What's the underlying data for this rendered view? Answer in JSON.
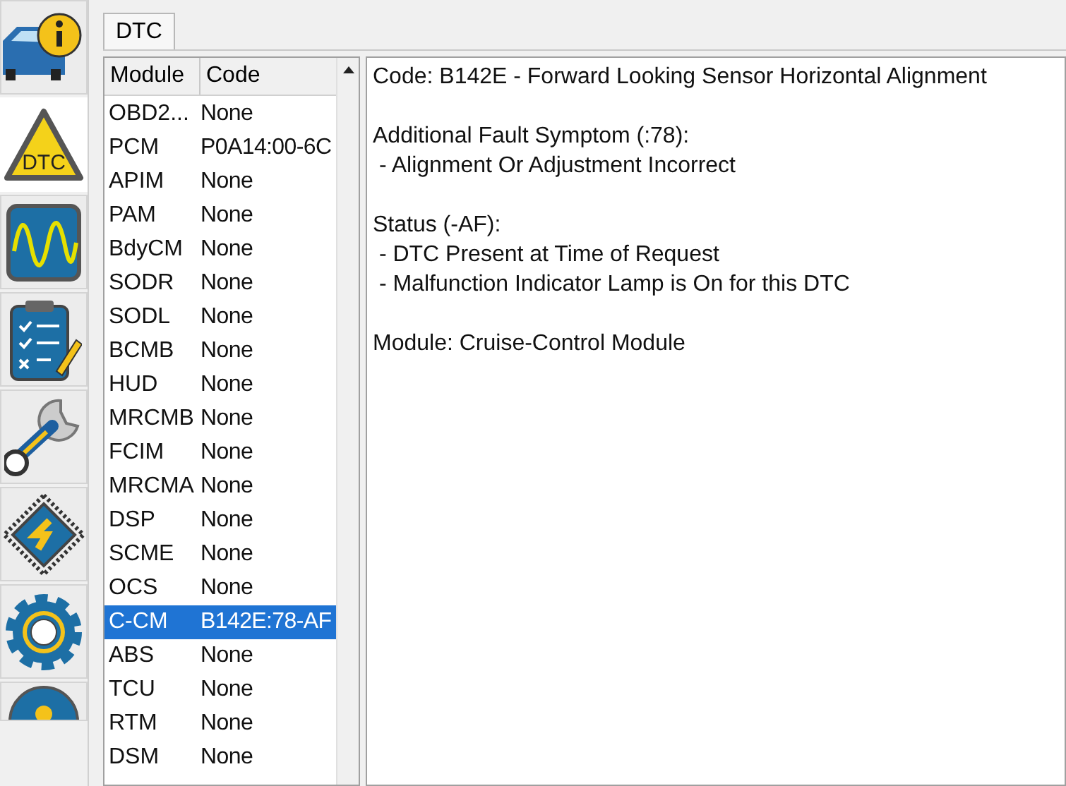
{
  "toolbar": [
    {
      "kind": "vehicle-info",
      "selected": false
    },
    {
      "kind": "dtc",
      "label": "DTC",
      "selected": true
    },
    {
      "kind": "scope",
      "selected": false
    },
    {
      "kind": "checklist",
      "selected": false
    },
    {
      "kind": "wrench",
      "selected": false
    },
    {
      "kind": "chip",
      "selected": false
    },
    {
      "kind": "gear",
      "selected": false
    },
    {
      "kind": "partial",
      "selected": false
    }
  ],
  "tabs": [
    {
      "label": "DTC",
      "selected": true
    }
  ],
  "table": {
    "columns": [
      "Module",
      "Code"
    ],
    "rows": [
      {
        "module": "OBD2...",
        "code": "None",
        "selected": false
      },
      {
        "module": "PCM",
        "code": "P0A14:00-6C",
        "selected": false
      },
      {
        "module": "APIM",
        "code": "None",
        "selected": false
      },
      {
        "module": "PAM",
        "code": "None",
        "selected": false
      },
      {
        "module": "BdyCM",
        "code": "None",
        "selected": false
      },
      {
        "module": "SODR",
        "code": "None",
        "selected": false
      },
      {
        "module": "SODL",
        "code": "None",
        "selected": false
      },
      {
        "module": "BCMB",
        "code": "None",
        "selected": false
      },
      {
        "module": "HUD",
        "code": "None",
        "selected": false
      },
      {
        "module": "MRCMB",
        "code": "None",
        "selected": false
      },
      {
        "module": "FCIM",
        "code": "None",
        "selected": false
      },
      {
        "module": "MRCMA",
        "code": "None",
        "selected": false
      },
      {
        "module": "DSP",
        "code": "None",
        "selected": false
      },
      {
        "module": "SCME",
        "code": "None",
        "selected": false
      },
      {
        "module": "OCS",
        "code": "None",
        "selected": false
      },
      {
        "module": "C-CM",
        "code": "B142E:78-AF",
        "selected": true
      },
      {
        "module": "ABS",
        "code": "None",
        "selected": false
      },
      {
        "module": "TCU",
        "code": "None",
        "selected": false
      },
      {
        "module": "RTM",
        "code": "None",
        "selected": false
      },
      {
        "module": "DSM",
        "code": "None",
        "selected": false
      }
    ]
  },
  "details": [
    [
      "Code: B142E - Forward Looking Sensor Horizontal Alignment"
    ],
    [
      "Additional Fault Symptom (:78):",
      " - Alignment Or Adjustment Incorrect"
    ],
    [
      "Status (-AF):",
      " - DTC Present at Time of Request",
      " - Malfunction Indicator Lamp is On for this DTC"
    ],
    [
      "Module: Cruise-Control Module"
    ]
  ]
}
